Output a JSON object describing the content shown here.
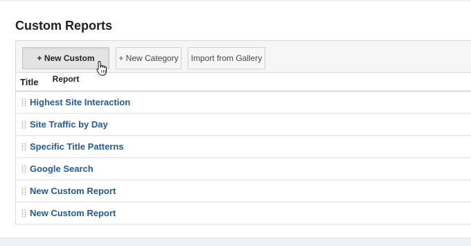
{
  "page": {
    "title": "Custom Reports"
  },
  "toolbar": {
    "new_report_label": "+ New Custom Report",
    "new_category_label": "+ New Category",
    "import_label": "Import from Gallery"
  },
  "table": {
    "header_title": "Title",
    "rows": [
      {
        "title": "Highest Site Interaction"
      },
      {
        "title": "Site Traffic by Day"
      },
      {
        "title": "Specific Title Patterns"
      },
      {
        "title": "Google Search"
      },
      {
        "title": "New Custom Report"
      },
      {
        "title": "New Custom Report"
      }
    ]
  },
  "colors": {
    "link": "#1f5b9a",
    "toolbar_bg": "#f6f6f6",
    "page_bg": "#eef1f5"
  },
  "icons": {
    "cursor": "hand-pointer-icon",
    "row_handle": "drag-handle-icon"
  }
}
